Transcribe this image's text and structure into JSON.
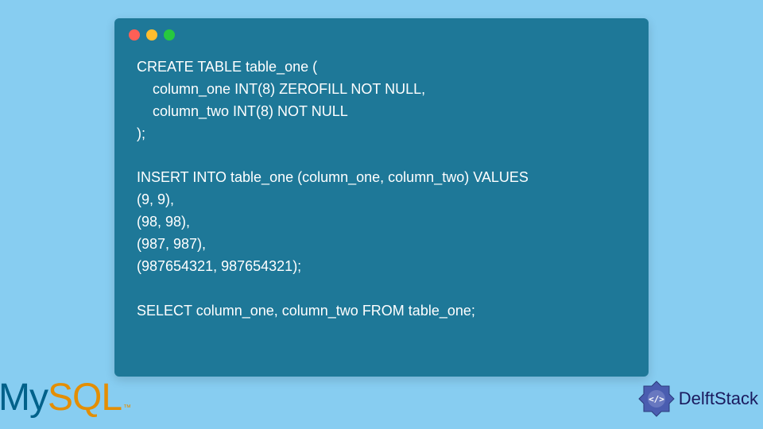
{
  "code": {
    "lines": [
      "CREATE TABLE table_one (",
      "    column_one INT(8) ZEROFILL NOT NULL,",
      "    column_two INT(8) NOT NULL",
      ");",
      "",
      "INSERT INTO table_one (column_one, column_two) VALUES",
      "(9, 9),",
      "(98, 98),",
      "(987, 987),",
      "(987654321, 987654321);",
      "",
      "SELECT column_one, column_two FROM table_one;"
    ]
  },
  "logos": {
    "mysql": {
      "part1": "My",
      "part2": "SQL",
      "tm": "™"
    },
    "delftstack": {
      "text": "DelftStack"
    }
  }
}
